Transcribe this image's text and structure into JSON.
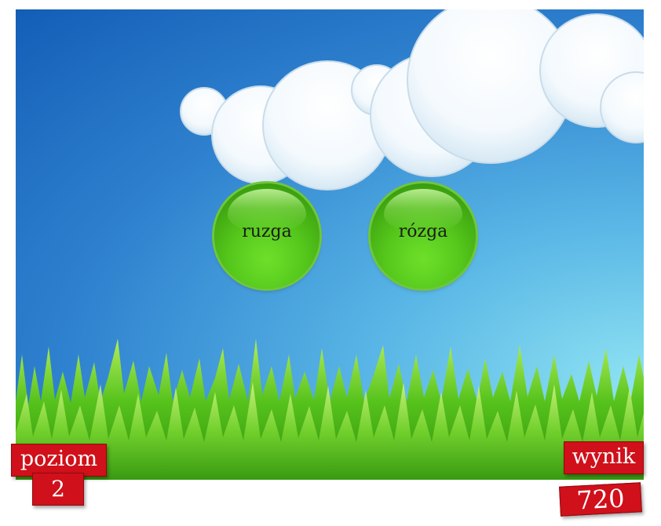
{
  "colors": {
    "sky_top": "#135db7",
    "sky_bottom": "#8fe3f2",
    "button_green": "#56c81c",
    "tag_red": "#d0101a"
  },
  "answers": [
    {
      "label": "ruzga"
    },
    {
      "label": "rózga"
    }
  ],
  "level": {
    "label": "poziom",
    "value": "2"
  },
  "score": {
    "label": "wynik",
    "value": "720"
  }
}
